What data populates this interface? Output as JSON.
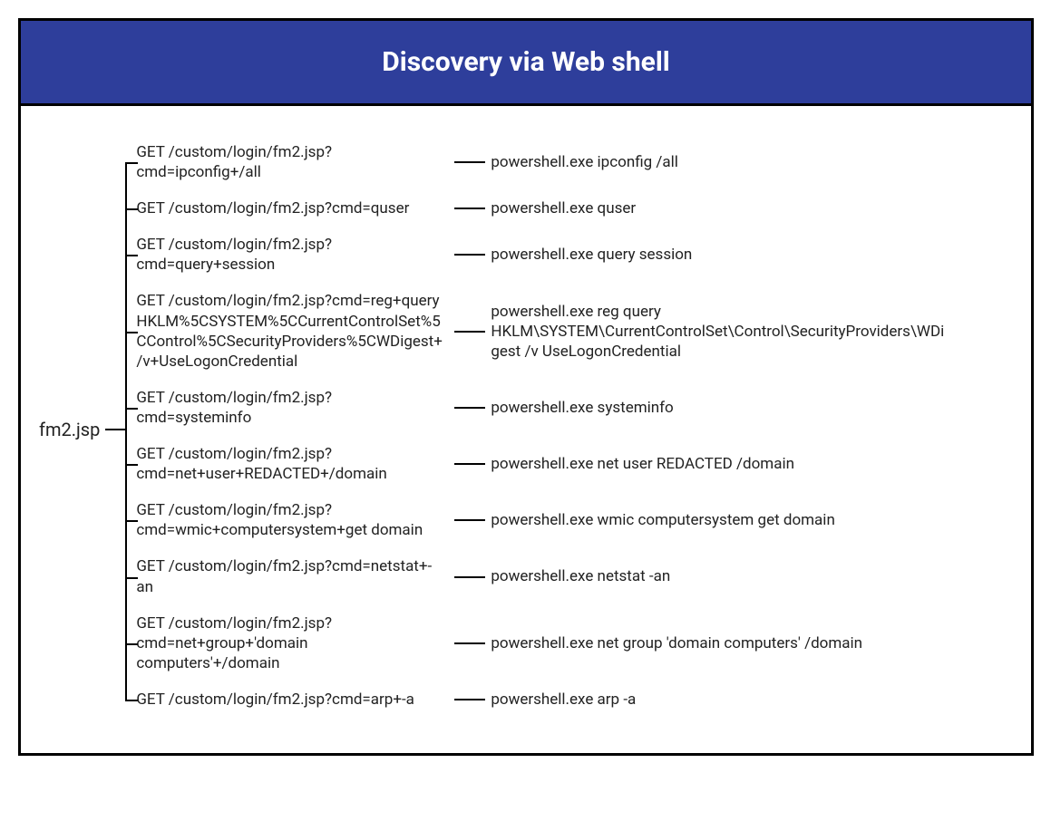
{
  "title": "Discovery via Web shell",
  "root": "fm2.jsp",
  "rows": [
    {
      "request": "GET /custom/login/fm2.jsp?cmd=ipconfig+/all",
      "command": "powershell.exe ipconfig /all"
    },
    {
      "request": "GET /custom/login/fm2.jsp?cmd=quser",
      "command": "powershell.exe quser"
    },
    {
      "request": "GET /custom/login/fm2.jsp?cmd=query+session",
      "command": "powershell.exe query session"
    },
    {
      "request": "GET /custom/login/fm2.jsp?cmd=reg+query HKLM%5CSYSTEM%5CCurrentControlSet%5CControl%5CSecurityProviders%5CWDigest+/v+UseLogonCredential",
      "command": "powershell.exe reg query HKLM\\SYSTEM\\CurrentControlSet\\Control\\SecurityProviders\\WDigest /v UseLogonCredential"
    },
    {
      "request": "GET /custom/login/fm2.jsp?cmd=systeminfo",
      "command": "powershell.exe systeminfo"
    },
    {
      "request": "GET /custom/login/fm2.jsp?cmd=net+user+REDACTED+/domain",
      "command": "powershell.exe net user REDACTED /domain"
    },
    {
      "request": "GET /custom/login/fm2.jsp?cmd=wmic+computersystem+get domain",
      "command": "powershell.exe wmic computersystem get domain"
    },
    {
      "request": "GET /custom/login/fm2.jsp?cmd=netstat+-an",
      "command": "powershell.exe netstat -an"
    },
    {
      "request": "GET /custom/login/fm2.jsp?cmd=net+group+'domain computers'+/domain",
      "command": "powershell.exe net group 'domain computers' /domain"
    },
    {
      "request": "GET /custom/login/fm2.jsp?cmd=arp+-a",
      "command": "powershell.exe arp -a"
    }
  ]
}
